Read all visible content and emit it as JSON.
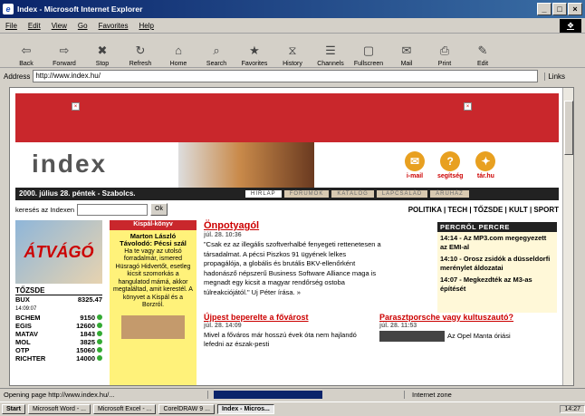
{
  "window": {
    "title": "Index - Microsoft Internet Explorer",
    "controls": [
      "_",
      "□",
      "×"
    ]
  },
  "menu": [
    "File",
    "Edit",
    "View",
    "Go",
    "Favorites",
    "Help"
  ],
  "toolbar": [
    {
      "label": "Back",
      "icon": "back-arrow-icon",
      "glyph": "⇦"
    },
    {
      "label": "Forward",
      "icon": "forward-arrow-icon",
      "glyph": "⇨"
    },
    {
      "label": "Stop",
      "icon": "stop-icon",
      "glyph": "✖"
    },
    {
      "label": "Refresh",
      "icon": "refresh-icon",
      "glyph": "↻"
    },
    {
      "label": "Home",
      "icon": "home-icon",
      "glyph": "⌂"
    },
    {
      "label": "Search",
      "icon": "search-icon",
      "glyph": "⌕"
    },
    {
      "label": "Favorites",
      "icon": "favorites-icon",
      "glyph": "★"
    },
    {
      "label": "History",
      "icon": "history-icon",
      "glyph": "⧖"
    },
    {
      "label": "Channels",
      "icon": "channels-icon",
      "glyph": "☰"
    },
    {
      "label": "Fullscreen",
      "icon": "fullscreen-icon",
      "glyph": "▢"
    },
    {
      "label": "Mail",
      "icon": "mail-icon",
      "glyph": "✉"
    },
    {
      "label": "Print",
      "icon": "print-icon",
      "glyph": "⎙"
    },
    {
      "label": "Edit",
      "icon": "edit-icon",
      "glyph": "✎"
    }
  ],
  "address": {
    "label": "Address",
    "url": "http://www.index.hu/",
    "links": "Links"
  },
  "page": {
    "logo": "index",
    "tools": [
      {
        "label": "i-mail"
      },
      {
        "label": "segítség"
      },
      {
        "label": "tár.hu"
      }
    ],
    "date": "2000. július 28. péntek - Szabolcs.",
    "tabs": [
      "HÍRLAP",
      "FÓRUMOK",
      "KATALÓG",
      "LAPCSALÁD",
      "ÁRUHÁZ"
    ],
    "search_label": "keresés az Indexen",
    "search_button": "Ok",
    "sections": "POLITIKA | TECH | TŐZSDE | KULT | SPORT",
    "avago": "ÁTVÁGÓ",
    "tozsde_title": "TŐZSDE",
    "bux": {
      "name": "BUX",
      "time": "14:09:07",
      "value": "8325.47"
    },
    "stocks": [
      {
        "name": "BCHEM",
        "value": "9150"
      },
      {
        "name": "EGIS",
        "value": "12600"
      },
      {
        "name": "MATAV",
        "value": "1843"
      },
      {
        "name": "MOL",
        "value": "3825"
      },
      {
        "name": "OTP",
        "value": "15060"
      },
      {
        "name": "RICHTER",
        "value": "14000"
      }
    ],
    "kispal": {
      "title": "Kispál-könyv",
      "headline": "Marton László Távolodó: Pécsi szál",
      "body": "Ha te vagy az utolsó forradalmár, ismered Hüsragó Hidvertőt, esetleg kicsit szomorkás a hangulatod mámá, akkor megtaláltad, amit kerestél. A könyvet a Kispál és a Borzról."
    },
    "main": {
      "headline": "Önpotyagól",
      "date": "júl. 28. 10:36",
      "text": "\"Csak ez az illegális szoftverhalbé fenyegeti rettenetesen a társadalmat. A pécsi Piszkos 91 ügyének lelkes propagálója, a globális és brutális BKV-ellenőrként hadonásző népszerű Business Software Alliance maga is megnadt egy kicsit a magyar rendőrség ostoba túlreakciójától.\" Uj Péter írása. »"
    },
    "sub1": {
      "headline": "Újpest beperelte a fővárost",
      "date": "júl. 28. 14:09",
      "text": "Mivel a főváros már hosszú évek óta nem hajlandó lefedni az észak-pesti"
    },
    "sub2": {
      "headline": "Paraszt­porsche vagy kultuszautó?",
      "date": "júl. 28. 11:53",
      "text": "Az Opel Manta óriási"
    },
    "percrol": {
      "title": "PERCRŐL PERCRE",
      "items": [
        "14:14 - Az MP3.com megegyezett az EMI-al",
        "14:10 - Orosz zsidók a düsseldorfi merénylet áldozatai",
        "14:07 - Megkezdték az M3-as építését"
      ]
    }
  },
  "status": {
    "message": "Opening page http://www.index.hu/...",
    "zone": "Internet zone"
  },
  "taskbar": {
    "start": "Start",
    "tasks": [
      {
        "label": "Microsoft Word - ...",
        "active": false
      },
      {
        "label": "Microsoft Excel - ...",
        "active": false
      },
      {
        "label": "CorelDRAW 9 ...",
        "active": false
      },
      {
        "label": "Index - Micros...",
        "active": true
      }
    ],
    "clock": "14:27"
  }
}
